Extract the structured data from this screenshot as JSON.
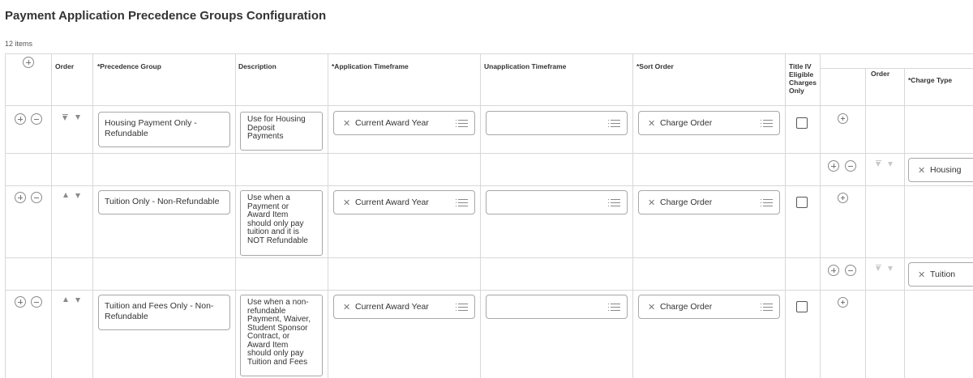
{
  "page": {
    "title": "Payment Application Precedence Groups Configuration",
    "item_count": "12 items"
  },
  "headers": {
    "order": "Order",
    "precedence_group": "*Precedence Group",
    "description": "Description",
    "application_timeframe": "*Application Timeframe",
    "unapplication_timeframe": "Unapplication Timeframe",
    "sort_order": "*Sort Order",
    "title_iv_line1": "Title IV",
    "title_iv_line2": "Eligible",
    "title_iv_line3": "Charges",
    "title_iv_line4": "Only",
    "sub_order": "Order",
    "charge_type": "*Charge Type"
  },
  "rows": [
    {
      "precedence_group_line1": "Housing Payment Only -",
      "precedence_group_line2": "Refundable",
      "description_lines": [
        "Use for Housing",
        "Deposit",
        "Payments"
      ],
      "application_timeframe": "Current Award Year",
      "unapplication_timeframe": "",
      "sort_order": "Charge Order",
      "title_iv_checked": false,
      "charge_type": "Housing"
    },
    {
      "precedence_group_line1": "Tuition Only - Non-Refundable",
      "precedence_group_line2": "",
      "description_lines": [
        "Use when a",
        "Payment or",
        "Award Item",
        "should only pay",
        "tuition and it is",
        "NOT Refundable"
      ],
      "application_timeframe": "Current Award Year",
      "unapplication_timeframe": "",
      "sort_order": "Charge Order",
      "title_iv_checked": false,
      "charge_type": "Tuition"
    },
    {
      "precedence_group_line1": "Tuition and Fees Only - Non-",
      "precedence_group_line2": "Refundable",
      "description_lines": [
        "Use when a non-",
        "refundable",
        "Payment, Waiver,",
        "Student Sponsor",
        "Contract, or",
        "Award Item",
        "should only pay",
        "Tuition and Fees"
      ],
      "application_timeframe": "Current Award Year",
      "unapplication_timeframe": "",
      "sort_order": "Charge Order",
      "title_iv_checked": false
    }
  ],
  "icons": {
    "add": "plus-circle-icon",
    "remove": "minus-circle-icon",
    "move_up": "triangle-up-icon",
    "move_down": "triangle-down-icon",
    "move_top": "move-to-top-icon",
    "clear": "x-icon",
    "prompt": "list-icon"
  },
  "colors": {
    "border": "#d8d8d8",
    "input_border": "#a8a8a8",
    "text": "#333333"
  }
}
